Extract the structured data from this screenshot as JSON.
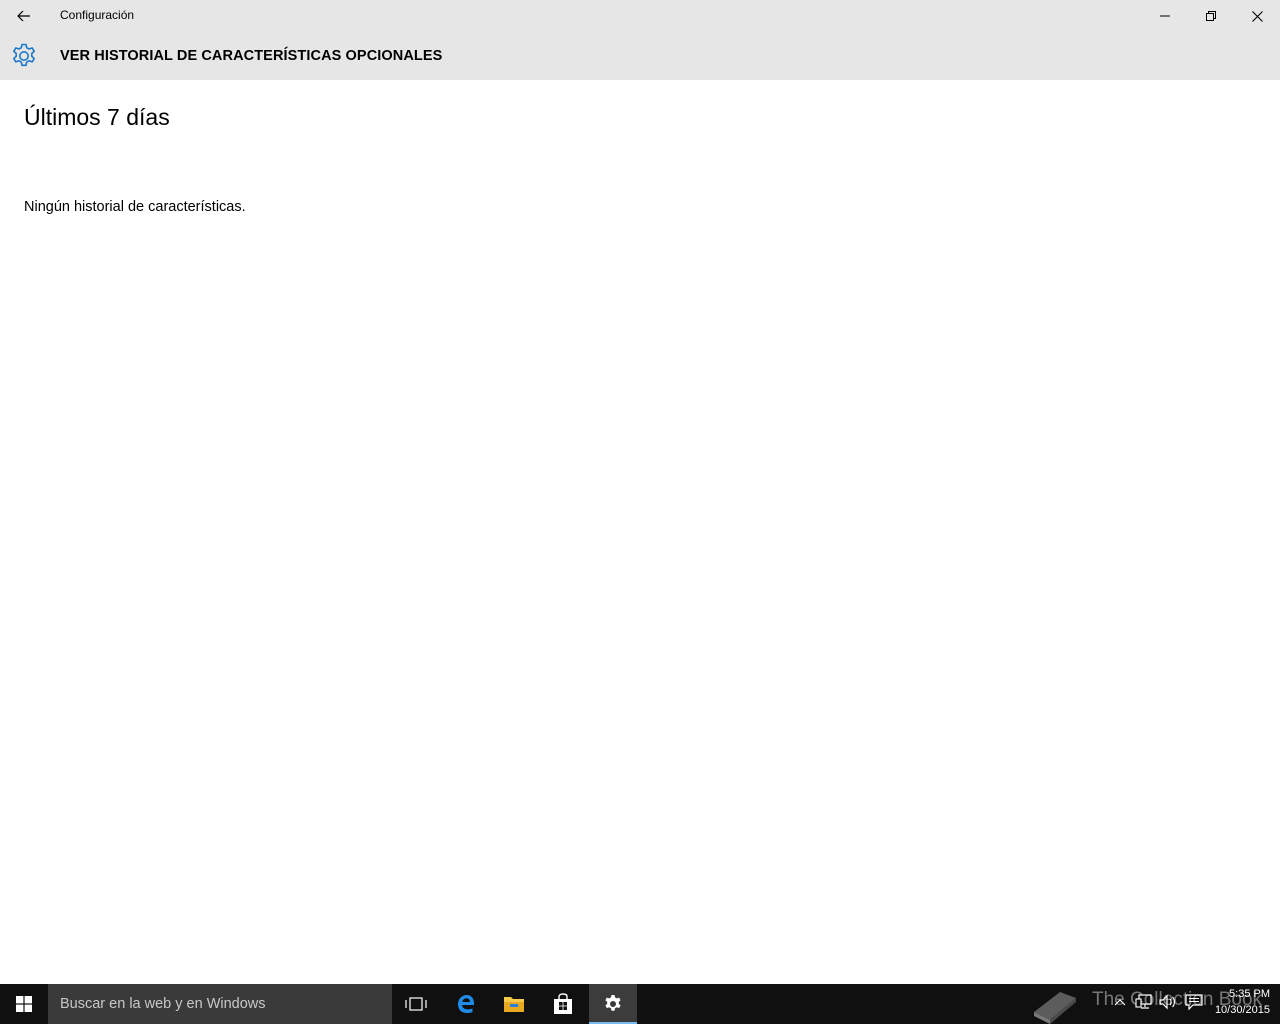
{
  "window": {
    "app_title": "Configuración"
  },
  "header": {
    "page_title": "VER HISTORIAL DE CARACTERÍSTICAS OPCIONALES"
  },
  "main": {
    "section_title": "Últimos 7 días",
    "empty_message": "Ningún historial de características."
  },
  "taskbar": {
    "search_placeholder": "Buscar en la web y en Windows",
    "pinned": [
      "task-view-icon",
      "edge-icon",
      "file-explorer-icon",
      "store-icon",
      "settings-icon"
    ],
    "active_app": "settings-icon",
    "watermark": "The Collection Book",
    "clock_time": "5:35 PM",
    "clock_date": "10/30/2015"
  },
  "colors": {
    "titlebar_bg": "#e6e6e6",
    "accent": "#1e78c8",
    "taskbar_bg": "#101010",
    "search_bg": "#3a3a3a"
  }
}
